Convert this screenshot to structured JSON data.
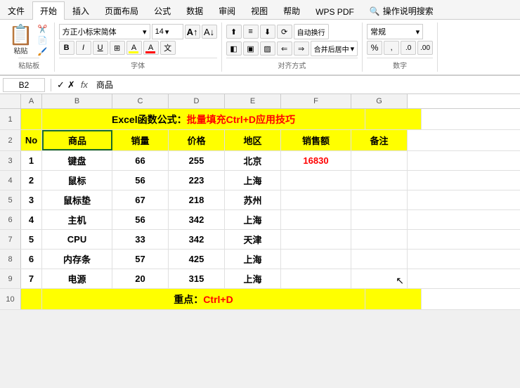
{
  "tabs": [
    {
      "label": "文件",
      "active": false
    },
    {
      "label": "开始",
      "active": true
    },
    {
      "label": "插入",
      "active": false
    },
    {
      "label": "页面布局",
      "active": false
    },
    {
      "label": "公式",
      "active": false
    },
    {
      "label": "数据",
      "active": false
    },
    {
      "label": "审阅",
      "active": false
    },
    {
      "label": "视图",
      "active": false
    },
    {
      "label": "帮助",
      "active": false
    },
    {
      "label": "WPS PDF",
      "active": false
    },
    {
      "label": "操作说明搜索",
      "active": false
    }
  ],
  "ribbon": {
    "paste_label": "粘贴板",
    "font_label": "字体",
    "align_label": "对齐方式",
    "num_label": "数字",
    "font_name": "方正小标宋简体",
    "font_size": "14",
    "wrap_text": "自动换行",
    "merge_center": "合并后居中",
    "number_format": "常规"
  },
  "formula_bar": {
    "cell_ref": "B2",
    "fx_label": "fx",
    "formula_value": "商品"
  },
  "columns": [
    {
      "label": "",
      "key": "rownum"
    },
    {
      "label": "A",
      "key": "a"
    },
    {
      "label": "B",
      "key": "b"
    },
    {
      "label": "C",
      "key": "c"
    },
    {
      "label": "D",
      "key": "d"
    },
    {
      "label": "E",
      "key": "e"
    },
    {
      "label": "F",
      "key": "f"
    },
    {
      "label": "G",
      "key": "g"
    }
  ],
  "rows": [
    {
      "rownum": "1",
      "a": "",
      "b_colspan": true,
      "b": "Excel函数公式：批量填充Ctrl+D应用技巧",
      "c": "",
      "d": "",
      "e": "",
      "f": "",
      "g": "",
      "style": "yellow title"
    },
    {
      "rownum": "2",
      "a": "No",
      "b": "商品",
      "c": "销量",
      "d": "价格",
      "e": "地区",
      "f": "销售额",
      "g": "备注",
      "style": "yellow header"
    },
    {
      "rownum": "3",
      "a": "1",
      "b": "键盘",
      "c": "66",
      "d": "255",
      "e": "北京",
      "f": "16830",
      "f_red": true,
      "g": "",
      "style": "normal"
    },
    {
      "rownum": "4",
      "a": "2",
      "b": "鼠标",
      "c": "56",
      "d": "223",
      "e": "上海",
      "f": "",
      "g": "",
      "style": "normal"
    },
    {
      "rownum": "5",
      "a": "3",
      "b": "鼠标垫",
      "c": "67",
      "d": "218",
      "e": "苏州",
      "f": "",
      "g": "",
      "style": "normal"
    },
    {
      "rownum": "6",
      "a": "4",
      "b": "主机",
      "c": "56",
      "d": "342",
      "e": "上海",
      "f": "",
      "g": "",
      "style": "normal"
    },
    {
      "rownum": "7",
      "a": "5",
      "b": "CPU",
      "c": "33",
      "d": "342",
      "e": "天津",
      "f": "",
      "g": "",
      "style": "normal"
    },
    {
      "rownum": "8",
      "a": "6",
      "b": "内存条",
      "c": "57",
      "d": "425",
      "e": "上海",
      "f": "",
      "g": "",
      "style": "normal"
    },
    {
      "rownum": "9",
      "a": "7",
      "b": "电源",
      "c": "20",
      "d": "315",
      "e": "上海",
      "f": "",
      "g": "",
      "style": "normal"
    },
    {
      "rownum": "10",
      "a": "",
      "b_colspan": true,
      "b": "重点：Ctrl+D",
      "c": "",
      "d": "",
      "e": "",
      "f": "",
      "g": "",
      "style": "yellow footer"
    }
  ]
}
